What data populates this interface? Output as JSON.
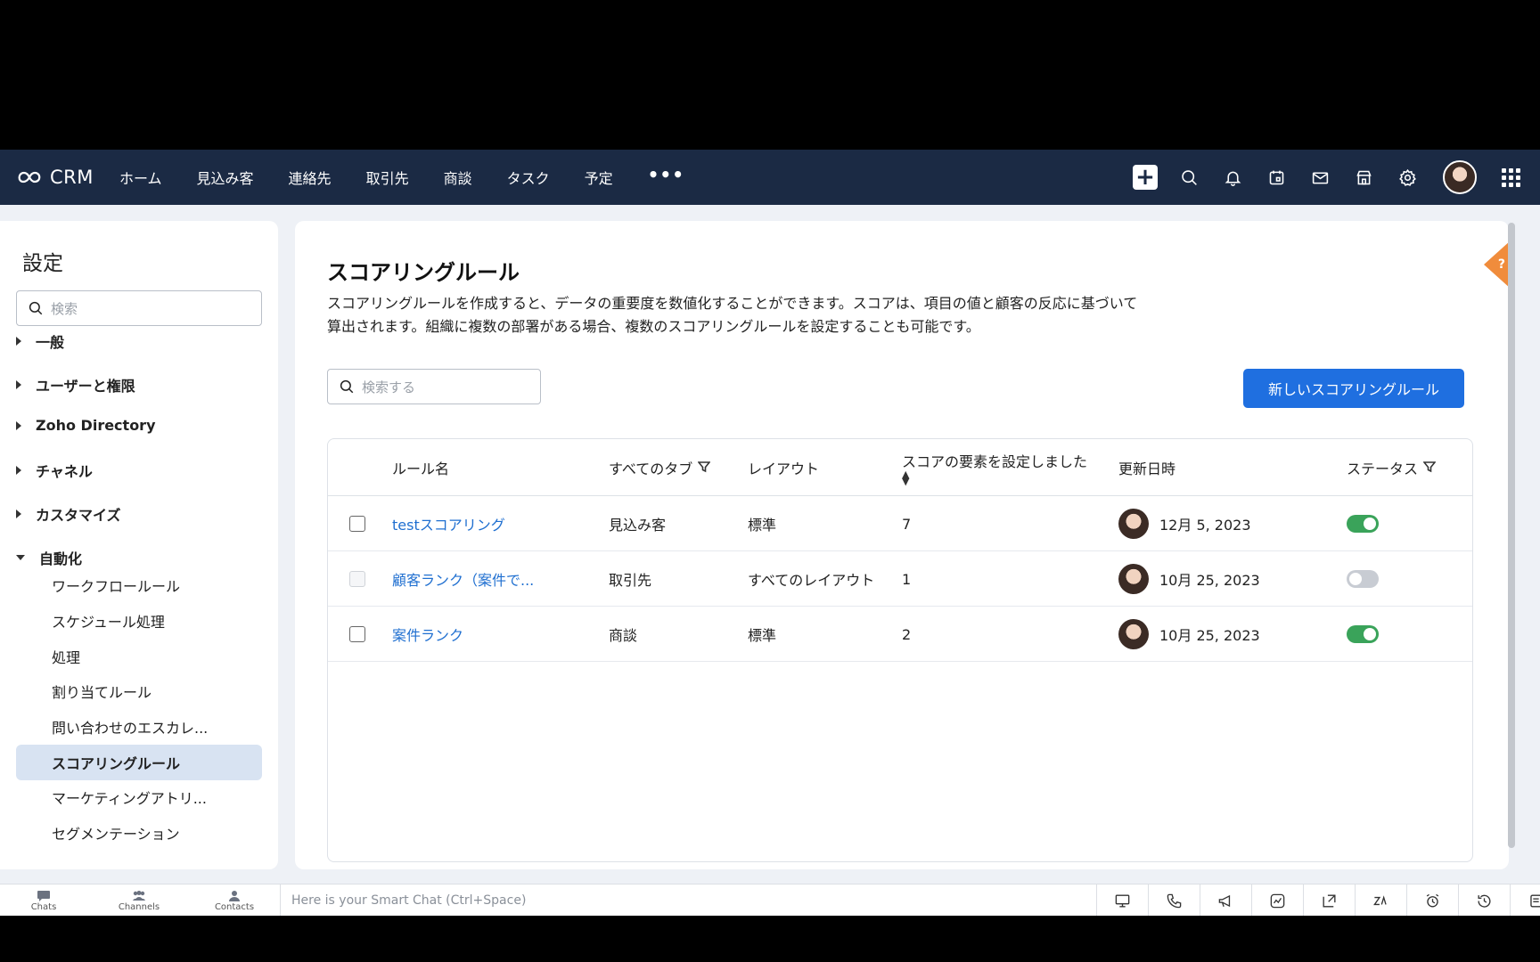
{
  "nav": {
    "brand": "CRM",
    "tabs": [
      "ホーム",
      "見込み客",
      "連絡先",
      "取引先",
      "商談",
      "タスク",
      "予定"
    ],
    "more": "•••"
  },
  "sidebar": {
    "title": "設定",
    "search_placeholder": "検索",
    "sections": [
      "一般",
      "ユーザーと権限",
      "Zoho Directory",
      "チャネル",
      "カスタマイズ",
      "自動化"
    ],
    "items": [
      "ワークフロールール",
      "スケジュール処理",
      "処理",
      "割り当てルール",
      "問い合わせのエスカレ...",
      "スコアリングルール",
      "マーケティングアトリ...",
      "セグメンテーション"
    ]
  },
  "main": {
    "title": "スコアリングルール",
    "description": "スコアリングルールを作成すると、データの重要度を数値化することができます。スコアは、項目の値と顧客の反応に基づいて算出されます。組織に複数の部署がある場合、複数のスコアリングルールを設定することも可能です。",
    "help": "?",
    "search_placeholder": "検索する",
    "new_button": "新しいスコアリングルール"
  },
  "table": {
    "headers": {
      "name": "ルール名",
      "tab": "すべてのタブ",
      "layout": "レイアウト",
      "elements": "スコアの要素を設定しました",
      "updated": "更新日時",
      "status": "ステータス"
    },
    "rows": [
      {
        "name": "testスコアリング",
        "tab": "見込み客",
        "layout": "標準",
        "elements": "7",
        "updated": "12月 5, 2023",
        "status": "on"
      },
      {
        "name": "顧客ランク（案件で...",
        "tab": "取引先",
        "layout": "すべてのレイアウト",
        "elements": "1",
        "updated": "10月 25, 2023",
        "status": "off"
      },
      {
        "name": "案件ランク",
        "tab": "商談",
        "layout": "標準",
        "elements": "2",
        "updated": "10月 25, 2023",
        "status": "on"
      }
    ]
  },
  "bottombar": {
    "tabs": [
      "Chats",
      "Channels",
      "Contacts"
    ],
    "smartchat": "Here is your Smart Chat (Ctrl+Space)"
  },
  "colors": {
    "nav_bg": "#1b2a44",
    "accent": "#1f6fe0",
    "link": "#1f6fd0",
    "toggle_on": "#3aa35a",
    "help_tab": "#f08c3c"
  }
}
